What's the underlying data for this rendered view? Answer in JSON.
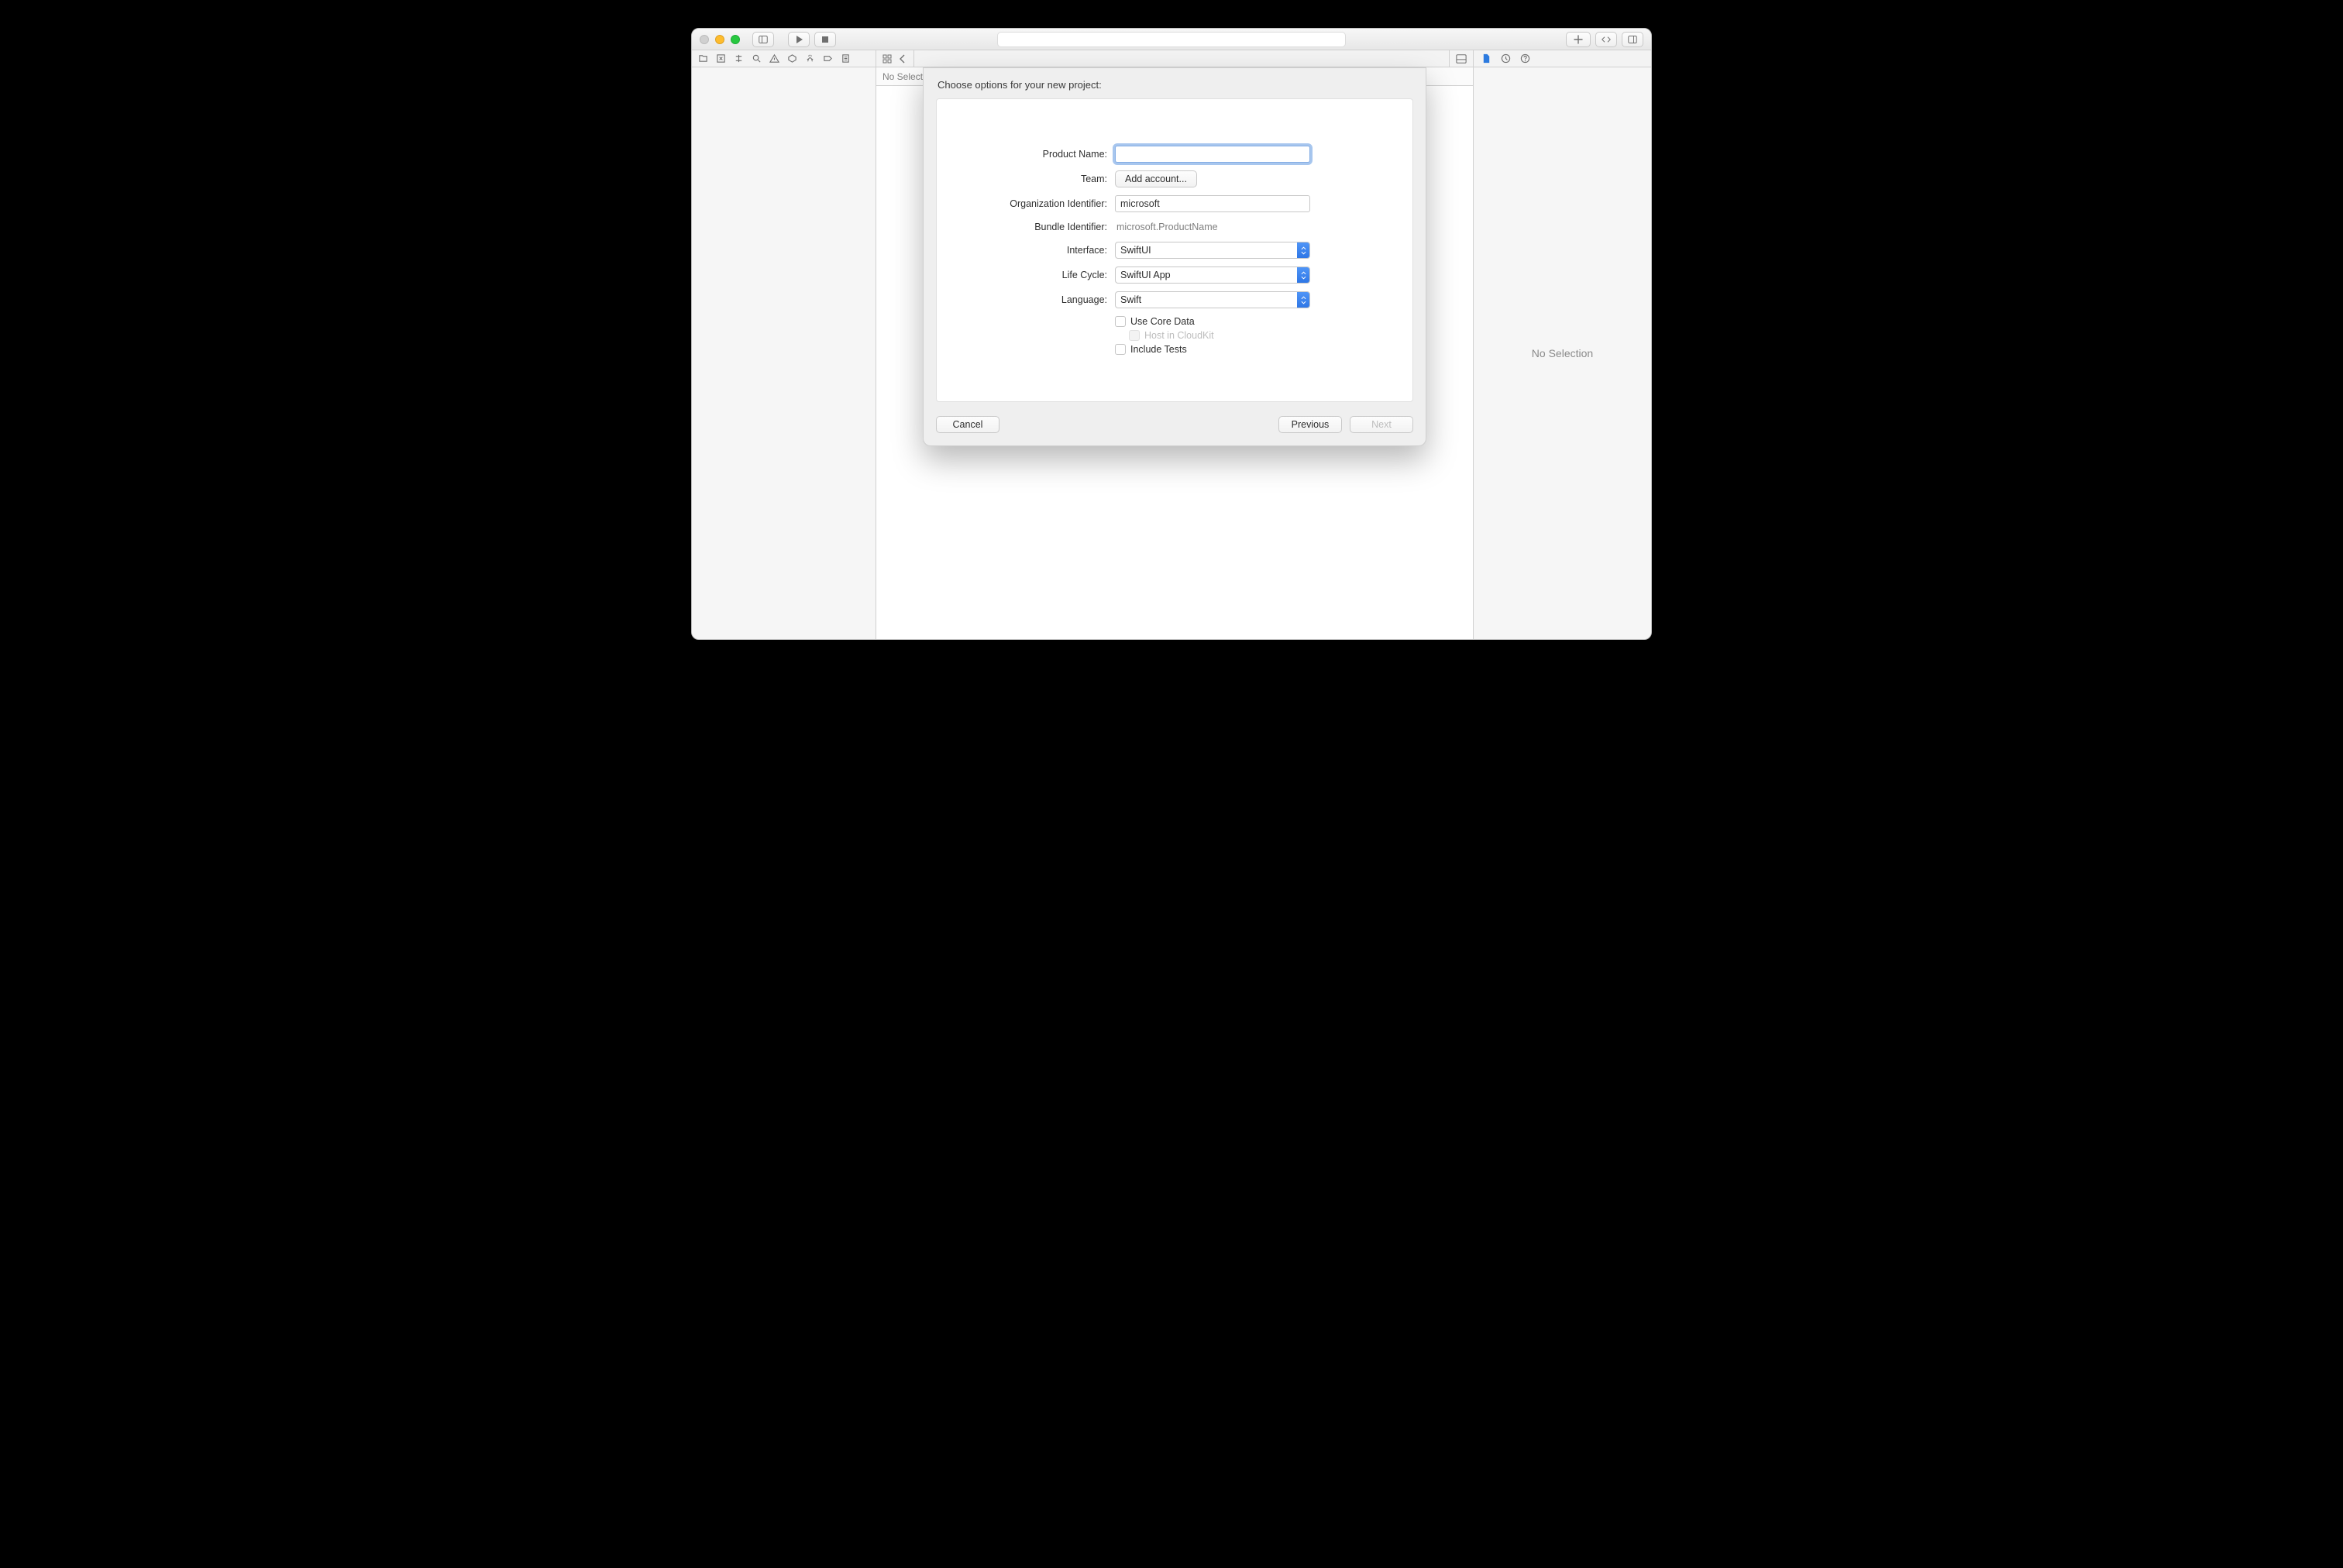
{
  "editor_bar": {
    "text": "No Selection"
  },
  "inspector": {
    "placeholder": "No Selection"
  },
  "sheet": {
    "title": "Choose options for your new project:",
    "labels": {
      "product_name": "Product Name:",
      "team": "Team:",
      "org_id": "Organization Identifier:",
      "bundle_id": "Bundle Identifier:",
      "interface": "Interface:",
      "life_cycle": "Life Cycle:",
      "language": "Language:"
    },
    "values": {
      "product_name": "",
      "team_button": "Add account...",
      "org_id": "microsoft",
      "bundle_id": "microsoft.ProductName",
      "interface": "SwiftUI",
      "life_cycle": "SwiftUI App",
      "language": "Swift"
    },
    "checks": {
      "core_data": "Use Core Data",
      "cloudkit": "Host in CloudKit",
      "tests": "Include Tests"
    },
    "buttons": {
      "cancel": "Cancel",
      "previous": "Previous",
      "next": "Next"
    }
  }
}
